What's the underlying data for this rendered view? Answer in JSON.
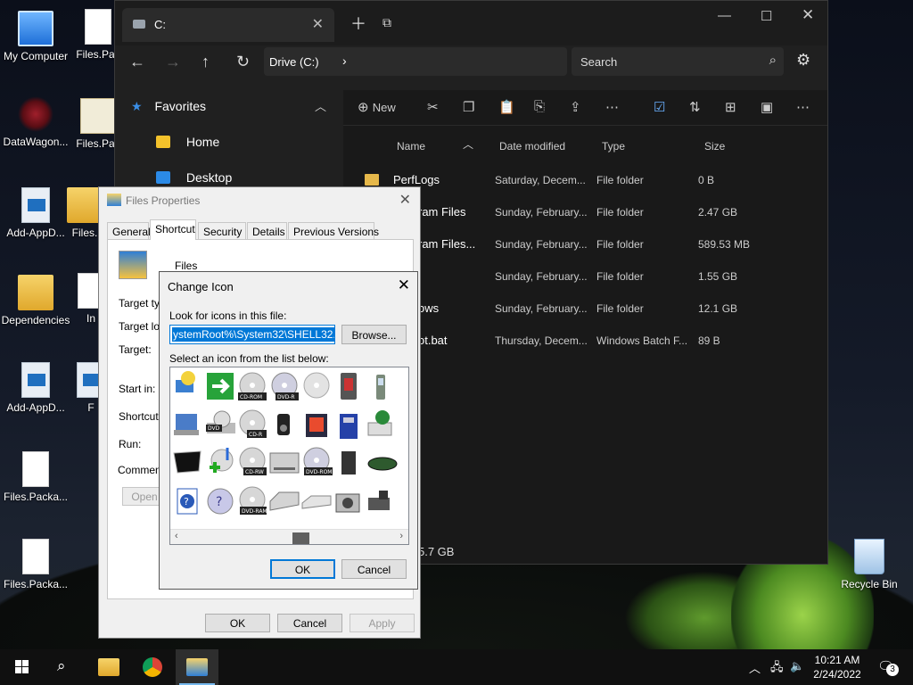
{
  "desktop": {
    "icons": [
      {
        "label": "My Computer",
        "kind": "pc"
      },
      {
        "label": "Files.Pac",
        "kind": "doc"
      },
      {
        "label": "DataWagon...",
        "kind": "star"
      },
      {
        "label": "Files.Pac",
        "kind": "cert"
      },
      {
        "label": "Add-AppD...",
        "kind": "script"
      },
      {
        "label": "Files.",
        "kind": "folder"
      },
      {
        "label": "Dependencies",
        "kind": "folder"
      },
      {
        "label": "In",
        "kind": "doc"
      },
      {
        "label": "Add-AppD...",
        "kind": "script"
      },
      {
        "label": "F",
        "kind": "script"
      },
      {
        "label": "Files.Packa...",
        "kind": "doc"
      },
      {
        "label": "Files.Packa...",
        "kind": "doc"
      },
      {
        "label": "Recycle Bin",
        "kind": "bin"
      }
    ]
  },
  "explorer": {
    "tab_title": "C:",
    "breadcrumb": "Drive (C:)",
    "search_placeholder": "Search",
    "sidebar": {
      "header": "Favorites",
      "items": [
        "Home",
        "Desktop"
      ]
    },
    "commandbar": {
      "new_label": "New"
    },
    "columns": {
      "name": "Name",
      "date": "Date modified",
      "type": "Type",
      "size": "Size"
    },
    "rows": [
      {
        "name": "PerfLogs",
        "date": "Saturday, Decem...",
        "type": "File folder",
        "size": "0 B"
      },
      {
        "name": "ram Files",
        "date": "Sunday, February...",
        "type": "File folder",
        "size": "2.47 GB"
      },
      {
        "name": "ram Files...",
        "date": "Sunday, February...",
        "type": "File folder",
        "size": "589.53 MB"
      },
      {
        "name": "",
        "date": "Sunday, February...",
        "type": "File folder",
        "size": "1.55 GB"
      },
      {
        "name": "ows",
        "date": "Sunday, February...",
        "type": "File folder",
        "size": "12.1 GB"
      },
      {
        "name": "ot.bat",
        "date": "Thursday, Decem...",
        "type": "Windows Batch F...",
        "size": "89 B"
      }
    ],
    "free_space": "5.7 GB"
  },
  "properties": {
    "title": "Files Properties",
    "tabs": [
      "General",
      "Shortcut",
      "Security",
      "Details",
      "Previous Versions"
    ],
    "active_tab": "Shortcut",
    "name": "Files",
    "labels": {
      "target_type": "Target typ",
      "target_location": "Target loc",
      "target": "Target:",
      "start_in": "Start in:",
      "shortcut_key": "Shortcut k",
      "run": "Run:",
      "comment": "Comment:"
    },
    "open_button": "Open",
    "ok": "OK",
    "cancel": "Cancel",
    "apply": "Apply"
  },
  "change_icon": {
    "title": "Change Icon",
    "look_label": "Look for icons in this file:",
    "path_value": "ystemRoot%\\System32\\SHELL32.dll",
    "browse": "Browse...",
    "select_label": "Select an icon from the list below:",
    "ok": "OK",
    "cancel": "Cancel",
    "icon_labels": {
      "cdrom": "CD-ROM",
      "dvdr": "DVD-R",
      "dvd": "DVD",
      "cdr": "CD-R",
      "cdrw": "CD-RW",
      "dvdrom": "DVD-ROM",
      "dvdram": "DVD-RAM"
    }
  },
  "taskbar": {
    "time": "10:21 AM",
    "date": "2/24/2022",
    "notification_count": "3"
  }
}
